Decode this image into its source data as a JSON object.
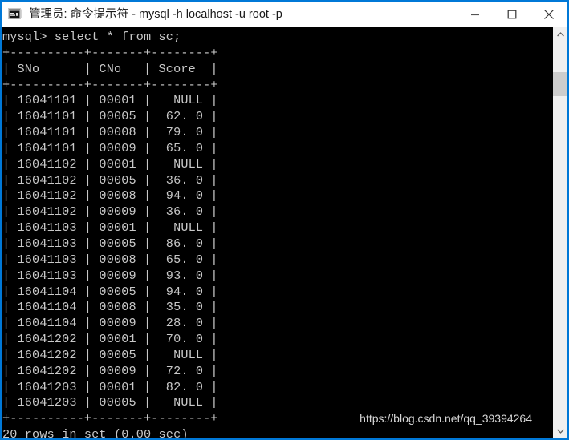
{
  "window": {
    "title": "管理员: 命令提示符 - mysql  -h localhost -u root -p",
    "icon": "console-icon",
    "controls": {
      "minimize": "—",
      "maximize": "□",
      "close": "✕"
    },
    "border_color": "#0078d7",
    "titlebar_bg": "#ffffff",
    "title_color": "#1a1a1a"
  },
  "console": {
    "bg_color": "#000000",
    "fg_color": "#c8c8c8",
    "prompt": "mysql>",
    "command": "select * from sc;",
    "prompt_line": "mysql> select * from sc;",
    "separator": "+----------+-------+--------+",
    "header_line": "|  SNo     | CNo   | Score  |",
    "columns": [
      "SNo",
      "CNo",
      "Score"
    ],
    "rows": [
      {
        "sno": "16041101",
        "cno": "00001",
        "score": "NULL"
      },
      {
        "sno": "16041101",
        "cno": "00005",
        "score": "62. 0"
      },
      {
        "sno": "16041101",
        "cno": "00008",
        "score": "79. 0"
      },
      {
        "sno": "16041101",
        "cno": "00009",
        "score": "65. 0"
      },
      {
        "sno": "16041102",
        "cno": "00001",
        "score": "NULL"
      },
      {
        "sno": "16041102",
        "cno": "00005",
        "score": "36. 0"
      },
      {
        "sno": "16041102",
        "cno": "00008",
        "score": "94. 0"
      },
      {
        "sno": "16041102",
        "cno": "00009",
        "score": "36. 0"
      },
      {
        "sno": "16041103",
        "cno": "00001",
        "score": "NULL"
      },
      {
        "sno": "16041103",
        "cno": "00005",
        "score": "86. 0"
      },
      {
        "sno": "16041103",
        "cno": "00008",
        "score": "65. 0"
      },
      {
        "sno": "16041103",
        "cno": "00009",
        "score": "93. 0"
      },
      {
        "sno": "16041104",
        "cno": "00005",
        "score": "94. 0"
      },
      {
        "sno": "16041104",
        "cno": "00008",
        "score": "35. 0"
      },
      {
        "sno": "16041104",
        "cno": "00009",
        "score": "28. 0"
      },
      {
        "sno": "16041202",
        "cno": "00001",
        "score": "70. 0"
      },
      {
        "sno": "16041202",
        "cno": "00005",
        "score": "NULL"
      },
      {
        "sno": "16041202",
        "cno": "00009",
        "score": "72. 0"
      },
      {
        "sno": "16041203",
        "cno": "00001",
        "score": "82. 0"
      },
      {
        "sno": "16041203",
        "cno": "00005",
        "score": "NULL"
      }
    ],
    "result_status": "20 rows in set (0.00 sec)",
    "row_count": 20,
    "elapsed": "0.00 sec"
  },
  "watermark": {
    "text": "https://blog.csdn.net/qq_39394264"
  },
  "scrollbar": {
    "up_arrow": "⌃",
    "down_arrow": "⌄",
    "thumb_color": "#cdcdcd",
    "track_color": "#f0f0f0"
  }
}
